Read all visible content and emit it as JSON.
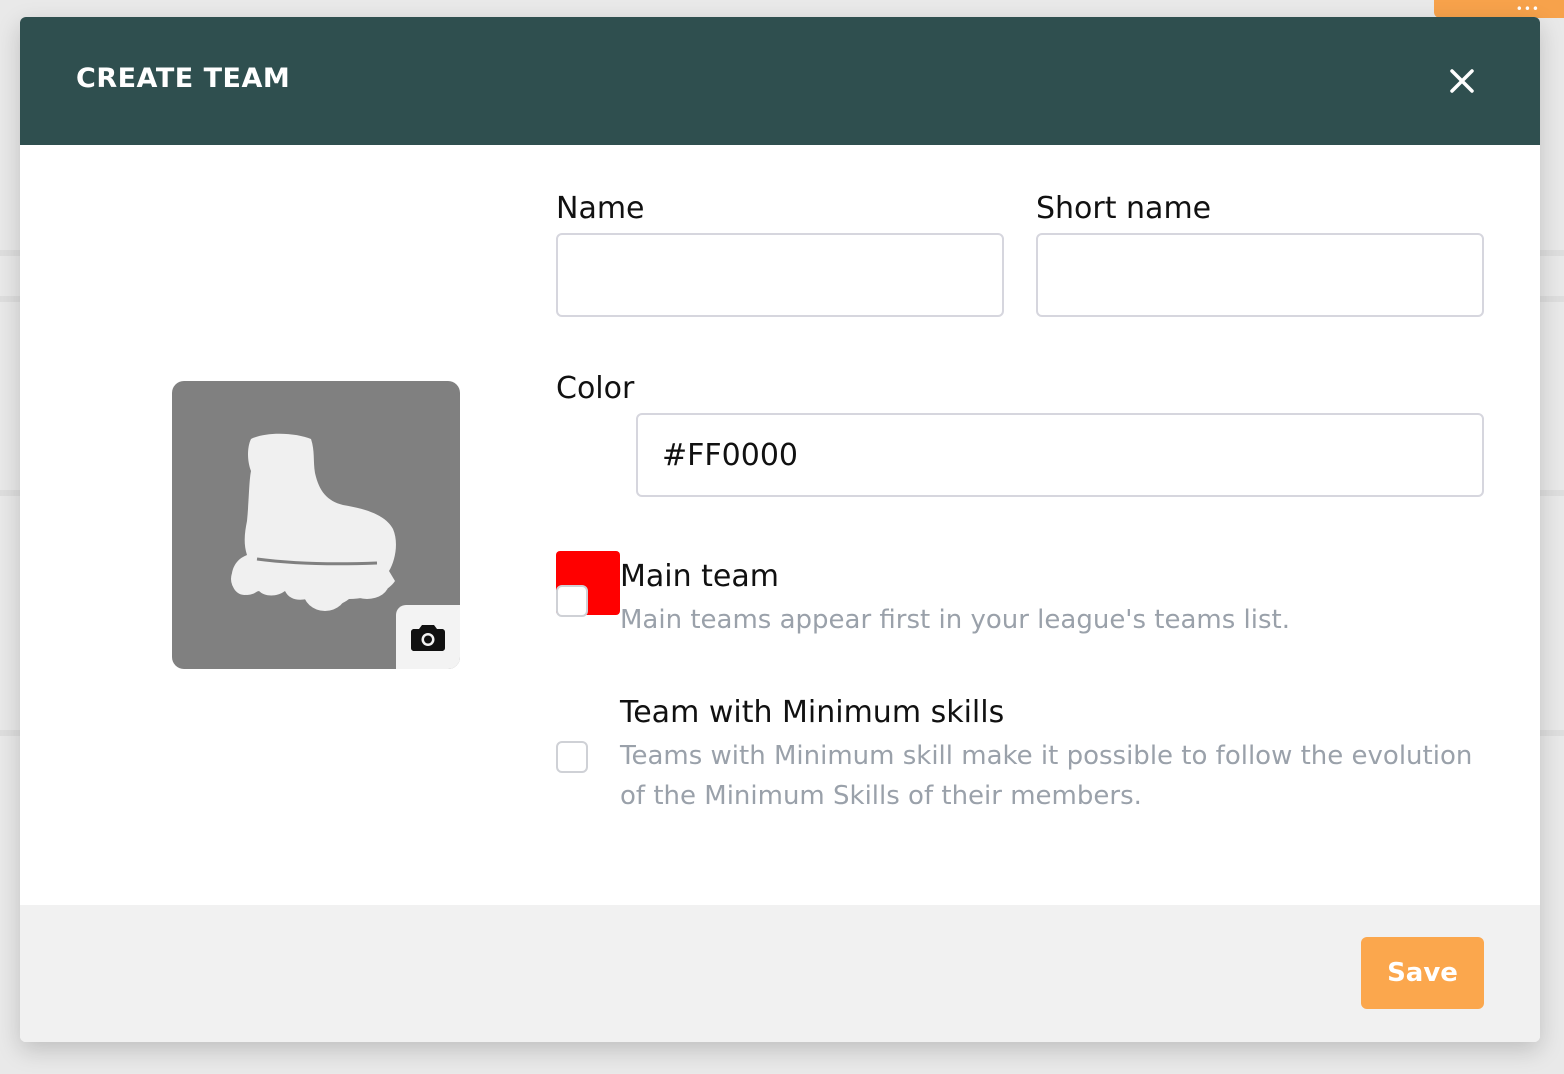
{
  "modal": {
    "title": "CREATE TEAM",
    "close_icon": "close-icon"
  },
  "avatar": {
    "image_icon": "roller-skate-icon",
    "upload_icon": "camera-icon",
    "background_color": "#808080"
  },
  "form": {
    "name_label": "Name",
    "name_value": "",
    "short_name_label": "Short name",
    "short_name_value": "",
    "color_label": "Color",
    "color_value": "#FF0000",
    "color_swatch": "#FF0000"
  },
  "options": {
    "main_team": {
      "title": "Main team",
      "description": "Main teams appear first in your league's teams list.",
      "checked": false
    },
    "minimum_skills": {
      "title": "Team with Minimum skills",
      "description": "Teams with Minimum skill make it possible to follow the evolution of the Minimum Skills of their members.",
      "checked": false
    }
  },
  "footer": {
    "save_label": "Save"
  },
  "colors": {
    "header": "#2F4F4F",
    "accent": "#FBA74D",
    "muted_text": "#9AA1AA"
  }
}
